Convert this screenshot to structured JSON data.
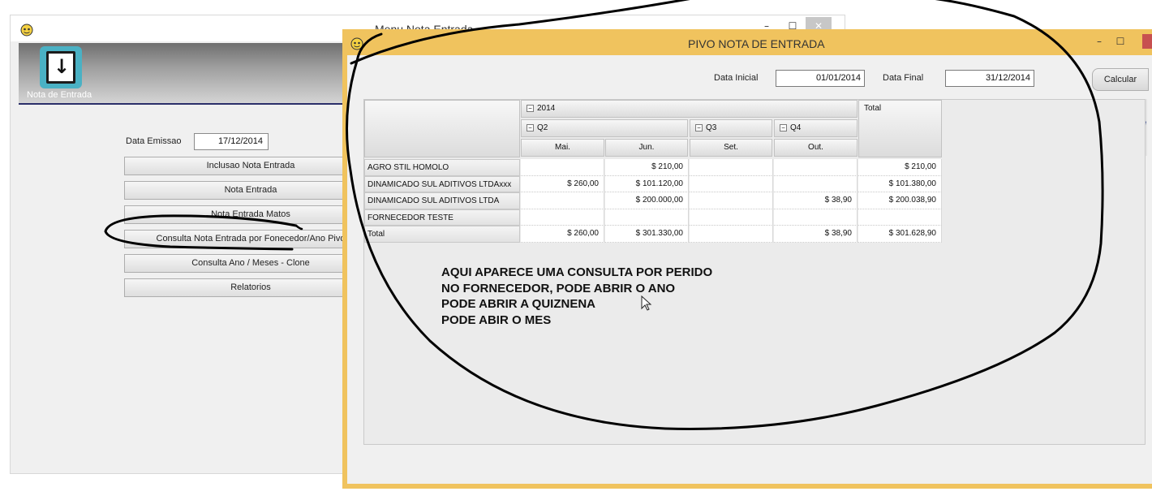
{
  "back_window": {
    "title": "Menu Nota Entrada",
    "min_glyph": "–",
    "max_glyph": "☐",
    "close_glyph": "✕",
    "tile_label": "Nota de Entrada",
    "data_emissao_label": "Data Emissao",
    "data_emissao_value": "17/12/2014",
    "menu_buttons": [
      "Inclusao Nota Entrada",
      "Nota Entrada",
      "Nota Entrada Matos",
      "Consulta Nota Entrada por Fonecedor/Ano Pivo",
      "Consulta Ano / Meses - Clone",
      "Relatorios"
    ]
  },
  "front_window": {
    "title": "PIVO NOTA DE ENTRADA",
    "min_glyph": "–",
    "max_glyph": "☐",
    "data_inicial_label": "Data Inicial",
    "data_inicial_value": "01/01/2014",
    "data_final_label": "Data Final",
    "data_final_value": "31/12/2014",
    "calcular_label": "Calcular"
  },
  "pivot": {
    "year": "2014",
    "quarters": [
      "Q2",
      "Q3",
      "Q4"
    ],
    "months": [
      "Mai.",
      "Jun.",
      "Set.",
      "Out."
    ],
    "total_header": "Total",
    "rows": [
      {
        "label": "AGRO STIL HOMOLO",
        "values": [
          "",
          "$ 210,00",
          "",
          ""
        ],
        "total": "$ 210,00"
      },
      {
        "label": "DINAMICADO SUL ADITIVOS LTDAxxx",
        "values": [
          "$ 260,00",
          "$ 101.120,00",
          "",
          ""
        ],
        "total": "$ 101.380,00"
      },
      {
        "label": "DINAMICADO SUL ADITIVOS LTDA",
        "values": [
          "",
          "$ 200.000,00",
          "",
          "$ 38,90"
        ],
        "total": "$ 200.038,90"
      },
      {
        "label": "FORNECEDOR TESTE",
        "values": [
          "",
          "",
          "",
          ""
        ],
        "total": ""
      },
      {
        "label": "Total",
        "values": [
          "$ 260,00",
          "$ 301.330,00",
          "",
          "$ 38,90"
        ],
        "total": "$ 301.628,90"
      }
    ]
  },
  "annotation": {
    "lines": [
      "AQUI APARECE UMA CONSULTA POR PERIDO",
      "NO FORNECEDOR, PODE ABRIR O ANO",
      "PODE ABRIR A QUIZNENA",
      "PODE ABIR O MES"
    ]
  }
}
